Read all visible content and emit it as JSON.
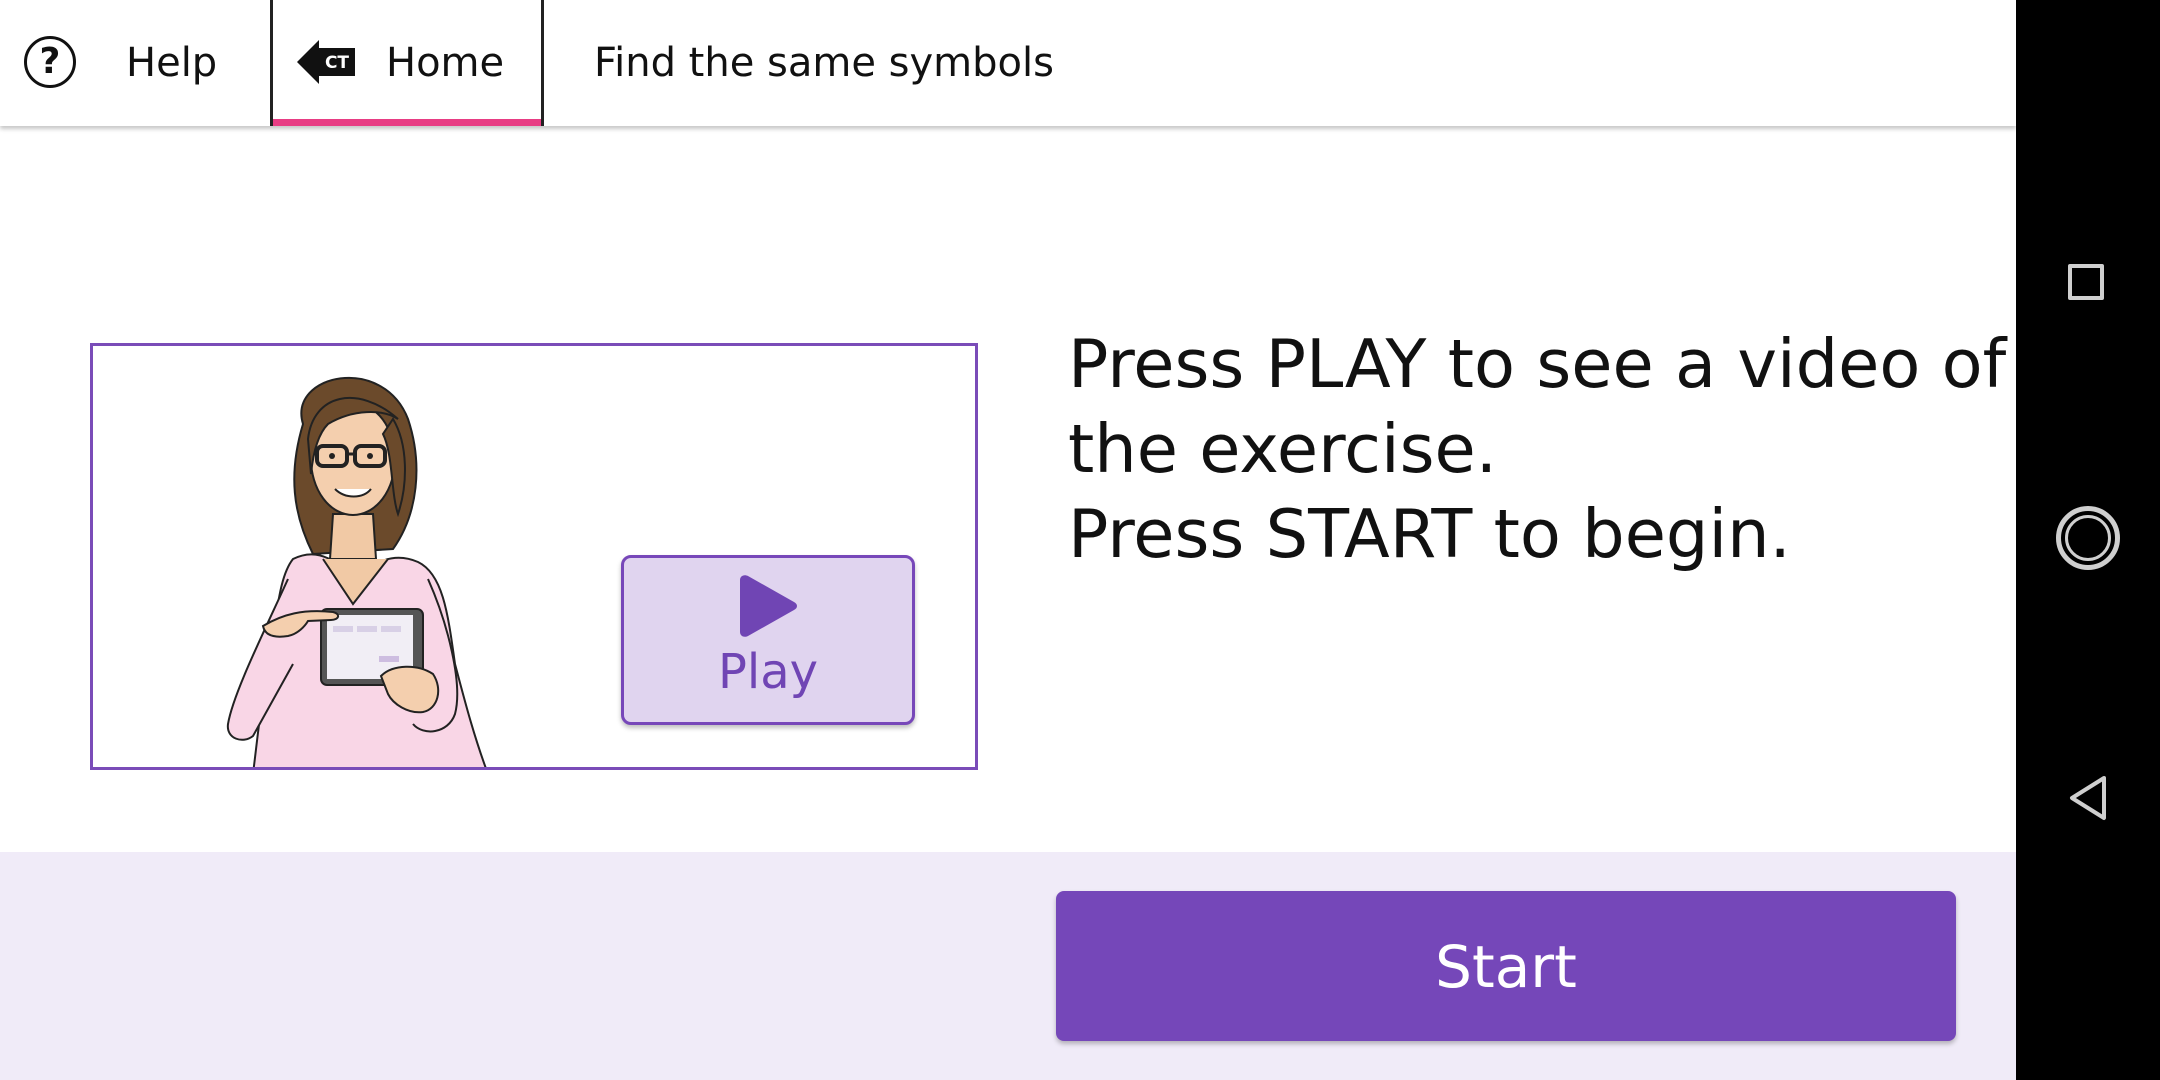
{
  "topbar": {
    "help_icon_glyph": "?",
    "help_label": "Help",
    "home_icon_badge": "CT",
    "home_label": "Home",
    "page_title": "Find the same symbols"
  },
  "video": {
    "play_label": "Play"
  },
  "instructions": {
    "line1": "Press PLAY to see a video of",
    "line2": "the exercise.",
    "line3": "Press START to begin."
  },
  "bottom": {
    "start_label": "Start"
  },
  "colors": {
    "accent_purple": "#7547b9",
    "play_button_bg": "#e0d4ef",
    "active_tab_underline": "#e83d84",
    "bottom_bar_bg": "#f0ebf8"
  },
  "icons": {
    "help": "question-circle-icon",
    "home": "back-arrow-ct-icon",
    "play": "play-triangle-icon",
    "nav_recents": "square-icon",
    "nav_home": "circle-icon",
    "nav_back": "triangle-back-icon"
  }
}
